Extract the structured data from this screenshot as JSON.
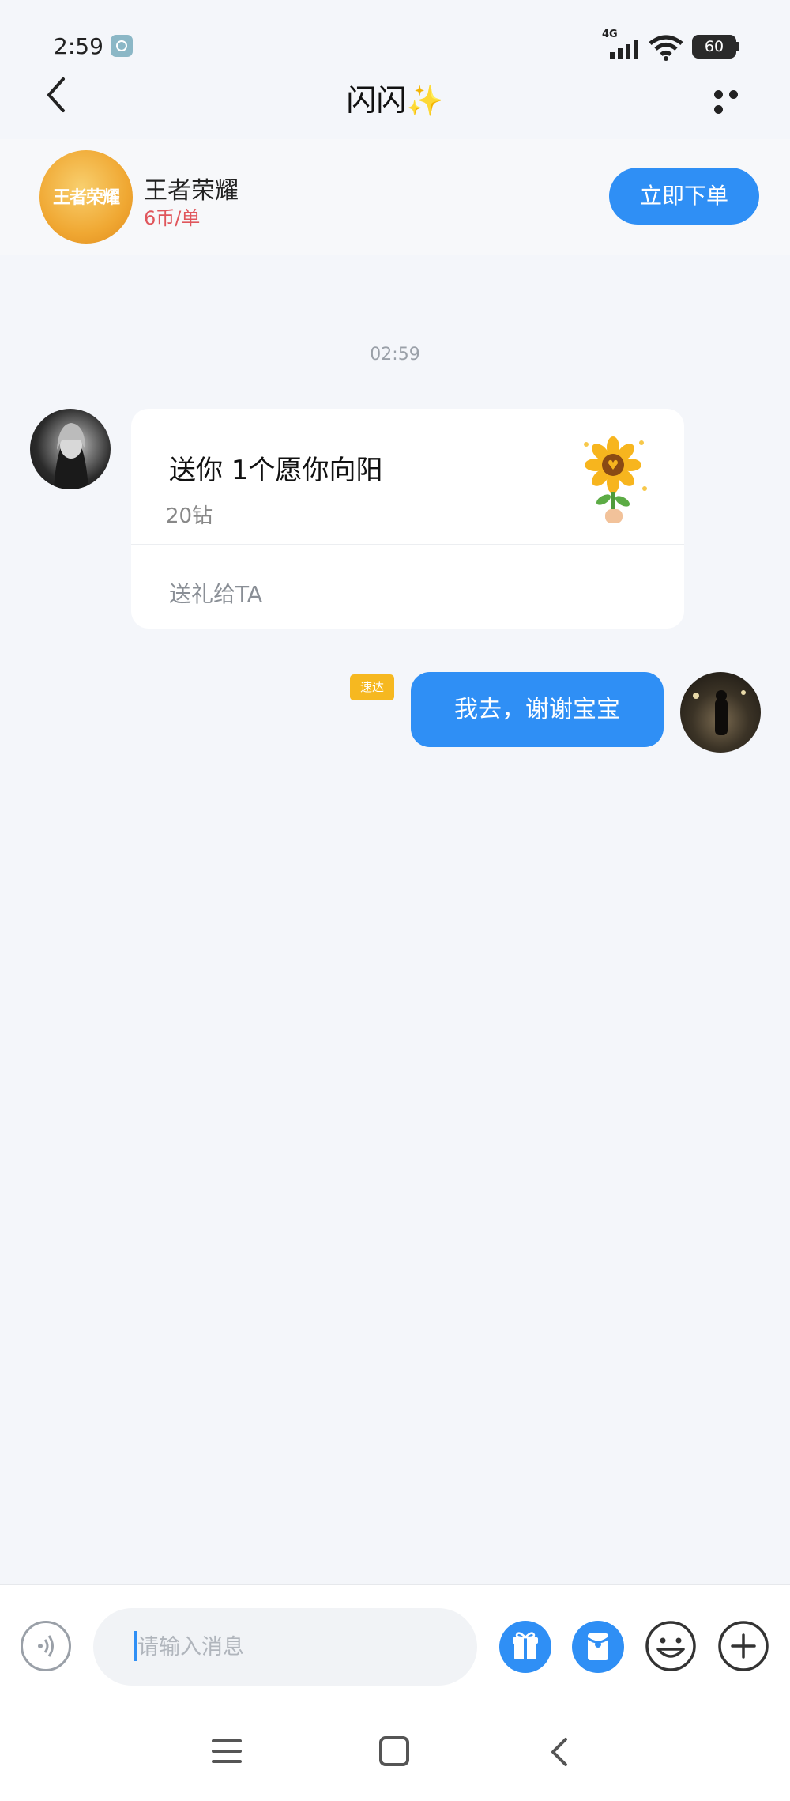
{
  "status_bar": {
    "time": "2:59",
    "network": "4G",
    "battery": "60"
  },
  "header": {
    "title": "闪闪✨"
  },
  "game": {
    "logo_text": "王者荣耀",
    "name": "王者荣耀",
    "price": "6币/单",
    "order_button": "立即下单"
  },
  "chat": {
    "timestamp": "02:59",
    "gift_message": {
      "text": "送你 1个愿你向阳",
      "price": "20钻",
      "send_label": "送礼给TA"
    },
    "my_message": {
      "badge": "速达",
      "text": "我去，谢谢宝宝"
    }
  },
  "input": {
    "placeholder": "请输入消息"
  },
  "colors": {
    "accent": "#2f8ff5",
    "price": "#e0565c",
    "badge": "#f6b820"
  },
  "icons": {
    "input_bar": [
      "voice-icon",
      "gift-icon",
      "red-packet-icon",
      "emoji-icon",
      "plus-icon"
    ],
    "system_nav": [
      "menu-icon",
      "home-icon",
      "back-icon"
    ]
  }
}
